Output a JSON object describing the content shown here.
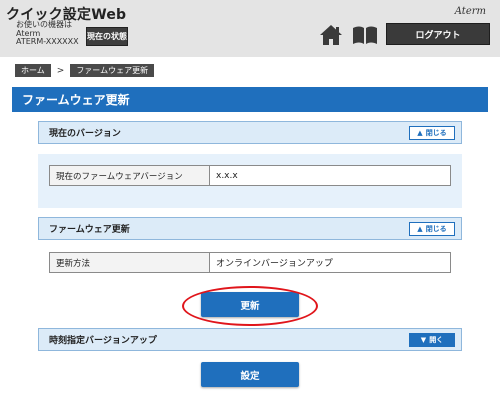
{
  "header": {
    "app_title": "クイック設定Web",
    "device_caption": "お使いの機器は",
    "device_name": "Aterm",
    "device_model": "ATERM-XXXXXX",
    "status_button": "現在の状態",
    "brand_logo": "Aterm",
    "logout_button": "ログアウト",
    "icons": [
      "home-icon",
      "book-icon"
    ]
  },
  "breadcrumb": {
    "items": [
      "ホーム",
      "ファームウェア更新"
    ],
    "separator": ">"
  },
  "page": {
    "title": "ファームウェア更新"
  },
  "sections": {
    "current_version": {
      "title": "現在のバージョン",
      "toggle": "閉じる",
      "toggle_icon": "chevron-up-icon",
      "rows": [
        {
          "label": "現在のファームウェアバージョン",
          "value": "x.x.x"
        }
      ]
    },
    "firmware_update": {
      "title": "ファームウェア更新",
      "toggle": "閉じる",
      "toggle_icon": "chevron-up-icon",
      "rows": [
        {
          "label": "更新方法",
          "value": "オンラインバージョンアップ"
        }
      ],
      "update_button": "更新"
    },
    "scheduled_update": {
      "title": "時刻指定バージョンアップ",
      "toggle": "開く",
      "toggle_icon": "chevron-down-icon"
    }
  },
  "footer": {
    "settings_button": "設定"
  },
  "colors": {
    "accent": "#1f6fbd",
    "header_bg": "#e4e4e4",
    "section_bg": "#e6f1fb",
    "highlight": "#e0151b"
  }
}
